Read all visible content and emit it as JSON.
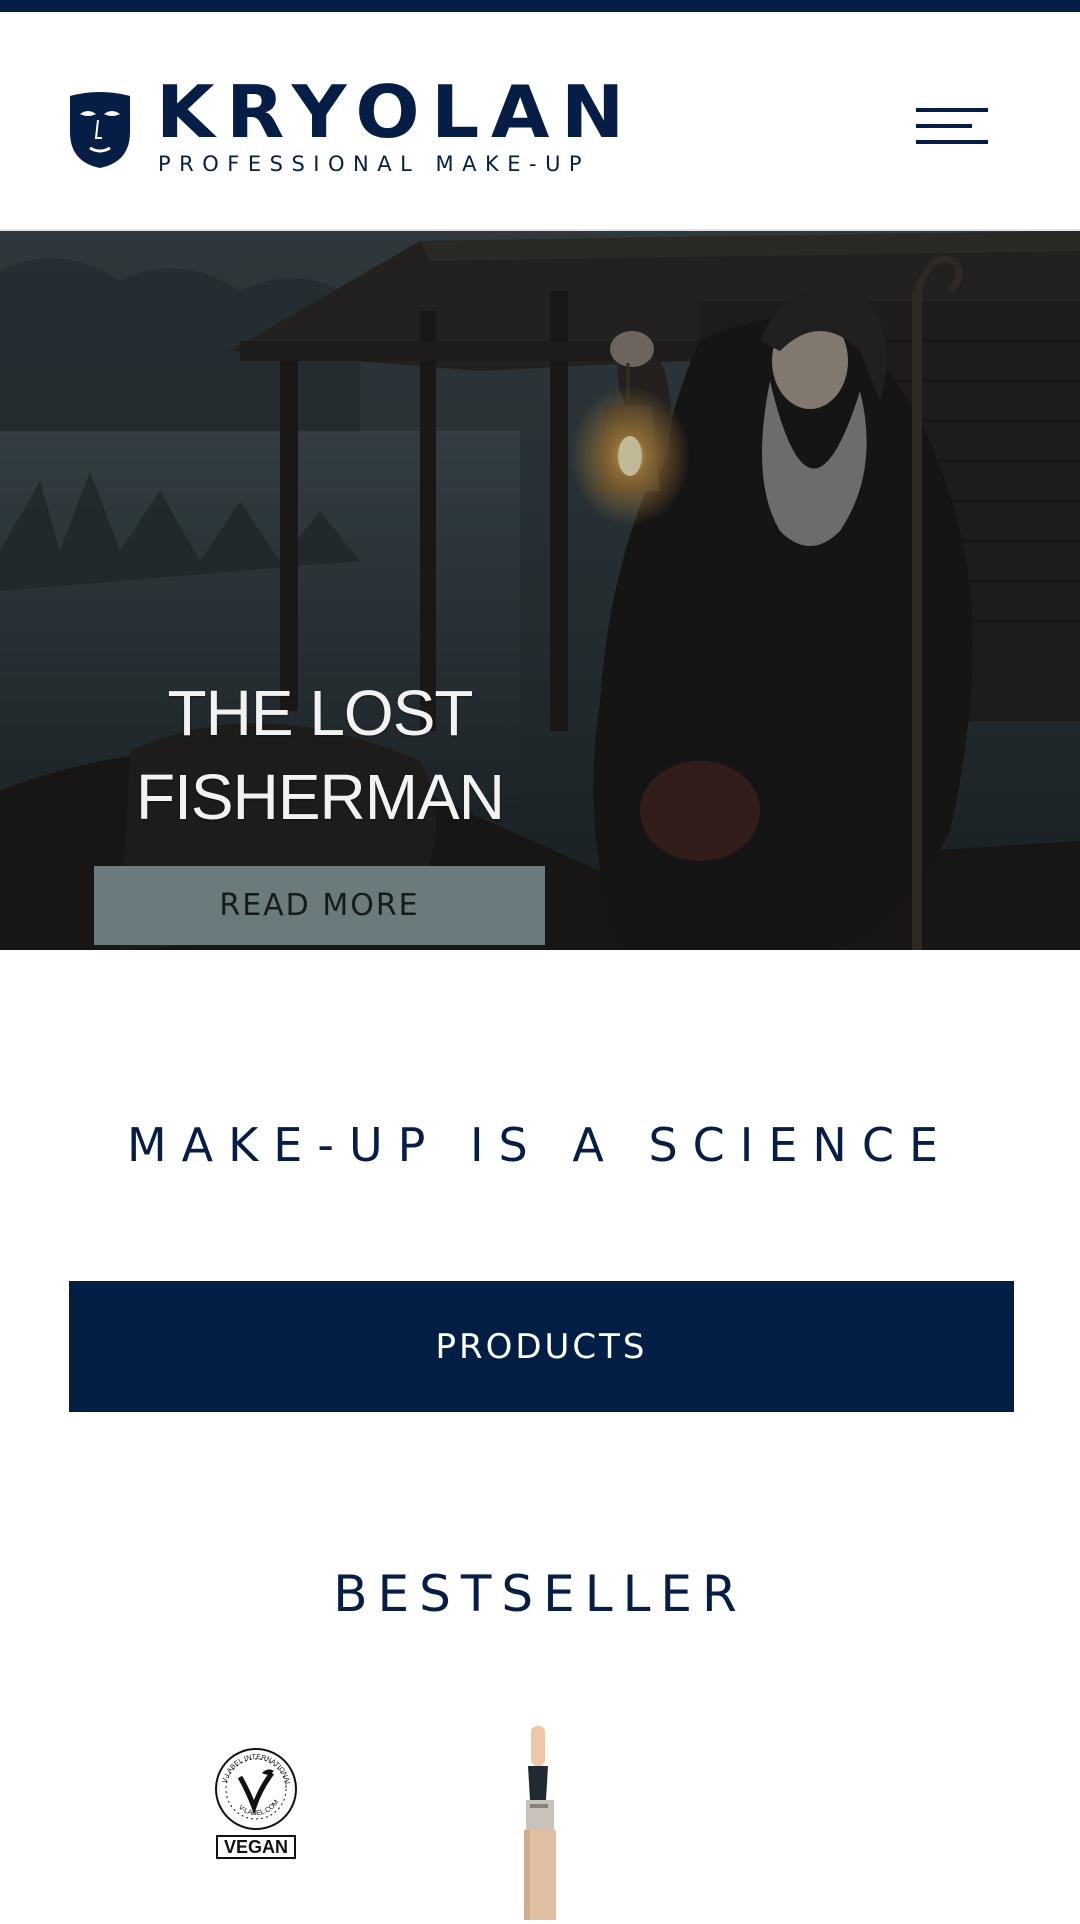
{
  "header": {
    "brand": "KRYOLAN",
    "tagline": "PROFESSIONAL MAKE-UP",
    "menu_icon": "hamburger-menu-icon"
  },
  "hero": {
    "title": "THE LOST\nFISHERMAN",
    "button_label": "READ MORE"
  },
  "main": {
    "tagline": "MAKE-UP IS A SCIENCE",
    "products_label": "PRODUCTS",
    "bestseller_heading": "BESTSELLER",
    "vegan_badge": {
      "ring_text": "V-LABEL INTERNATIONAL",
      "url_text": "V-LABEL.COM",
      "label": "VEGAN"
    }
  },
  "colors": {
    "brand_navy": "#021e45",
    "button_grey": "#6b7a7d",
    "white": "#ffffff"
  }
}
